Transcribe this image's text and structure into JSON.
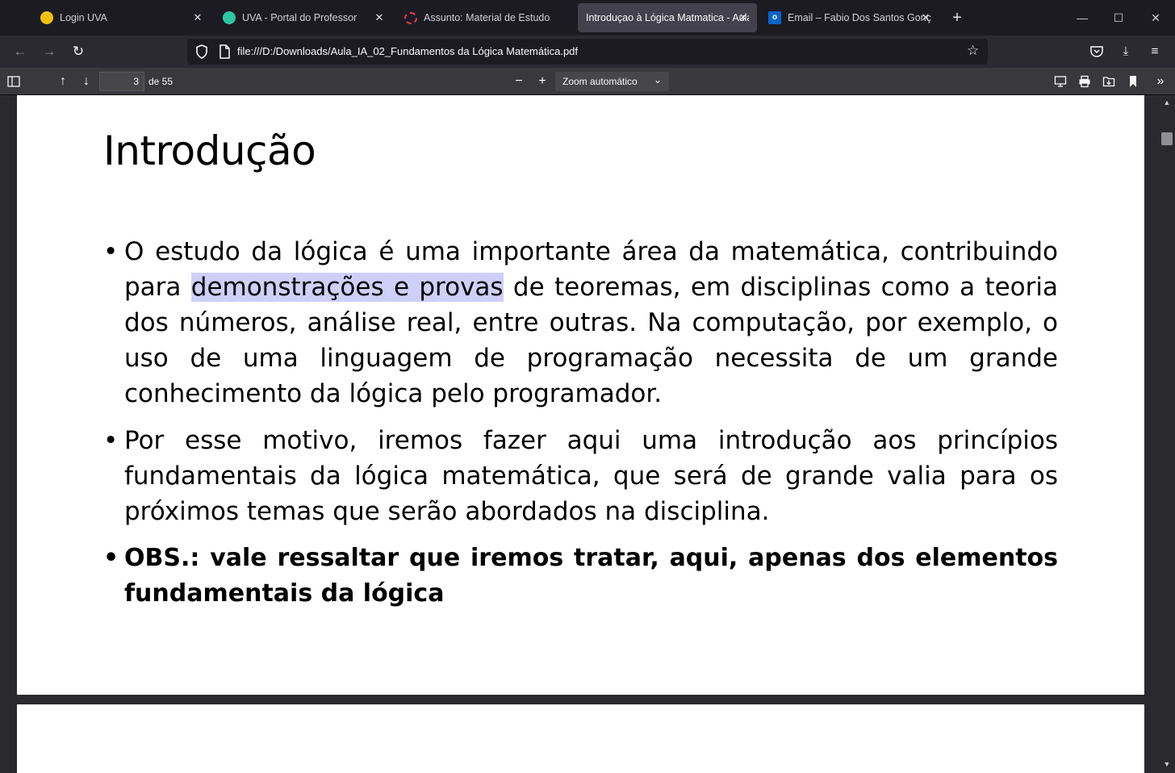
{
  "tabs": [
    {
      "title": "Login UVA",
      "favicon": "uva-dot-icon",
      "active": false
    },
    {
      "title": "UVA - Portal do Professor",
      "favicon": "portal-dot-icon",
      "active": false
    },
    {
      "title": "Assunto: Material de Estudo",
      "favicon": "loading-spinner-icon",
      "active": false
    },
    {
      "title": "Introduçao à Lógica Matmatica - Aula",
      "favicon": "",
      "active": true
    },
    {
      "title": "Email – Fabio Dos Santos Gonçalves",
      "favicon": "outlook-icon",
      "active": false
    }
  ],
  "browser": {
    "close_glyph": "✕",
    "new_tab_glyph": "+",
    "url": "file:///D:/Downloads/Aula_IA_02_Fundamentos da Lógica Matemática.pdf"
  },
  "pdf_toolbar": {
    "page_number": "3",
    "page_count": "de 55",
    "zoom": "Zoom automático"
  },
  "slide": {
    "title": "Introdução",
    "bullet_glyph": "•",
    "bullet1_before": "O estudo da lógica é uma importante área da matemática, contribuindo para ",
    "bullet1_hl1": "demonstrações",
    "bullet1_hl2": "e",
    "bullet1_hl3": "provas",
    "bullet1_after": " de teoremas, em disciplinas como a teoria dos números, análise real, entre outras. Na computação, por exemplo, o uso de uma linguagem de programação necessita de um grande conhecimento da lógica pelo programador.",
    "bullet2": "Por esse motivo, iremos fazer aqui uma introdução aos princípios fundamentais da lógica matemática, que será de grande valia para os próximos temas que serão abordados na disciplina.",
    "bullet3": "OBS.: vale ressaltar que iremos tratar, aqui, apenas dos elementos fundamentais da lógica"
  },
  "colors": {
    "highlight": "#cfcffa",
    "tab_active": "#42414d",
    "toolbar": "#38383d"
  }
}
